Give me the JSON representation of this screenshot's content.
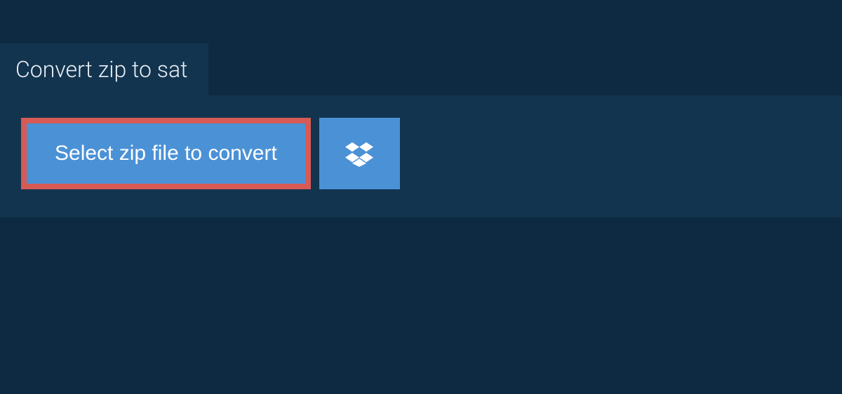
{
  "tab": {
    "label": "Convert zip to sat"
  },
  "actions": {
    "select_file_label": "Select zip file to convert"
  }
}
